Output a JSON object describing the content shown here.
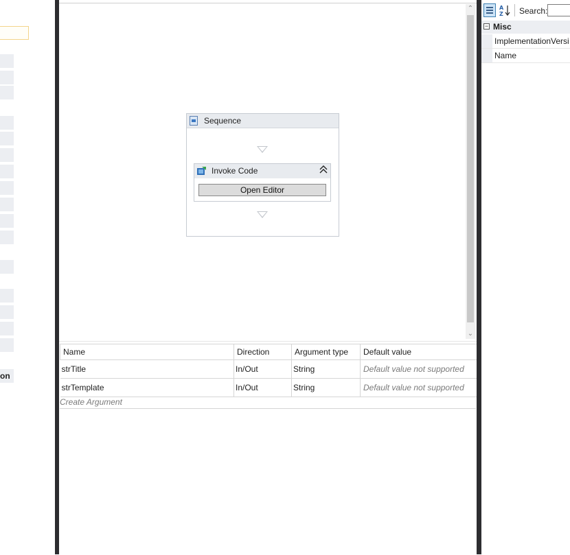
{
  "left_panel": {
    "cut_label": "on"
  },
  "designer": {
    "sequence": {
      "title": "Sequence",
      "icon": "sequence-icon"
    },
    "invoke_code": {
      "title": "Invoke Code",
      "icon": "invoke-code-icon",
      "collapse_icon": "double-chevron-up-icon",
      "open_editor_label": "Open Editor"
    }
  },
  "arguments": {
    "columns": [
      "Name",
      "Direction",
      "Argument type",
      "Default value"
    ],
    "rows": [
      {
        "name": "strTitle",
        "direction": "In/Out",
        "type": "String",
        "default": "Default value not supported"
      },
      {
        "name": "strTemplate",
        "direction": "In/Out",
        "type": "String",
        "default": "Default value not supported"
      }
    ],
    "create_label": "Create Argument"
  },
  "properties": {
    "search_label": "Search:",
    "search_value": "",
    "category": "Misc",
    "items": [
      "ImplementationVersi",
      "Name"
    ]
  }
}
